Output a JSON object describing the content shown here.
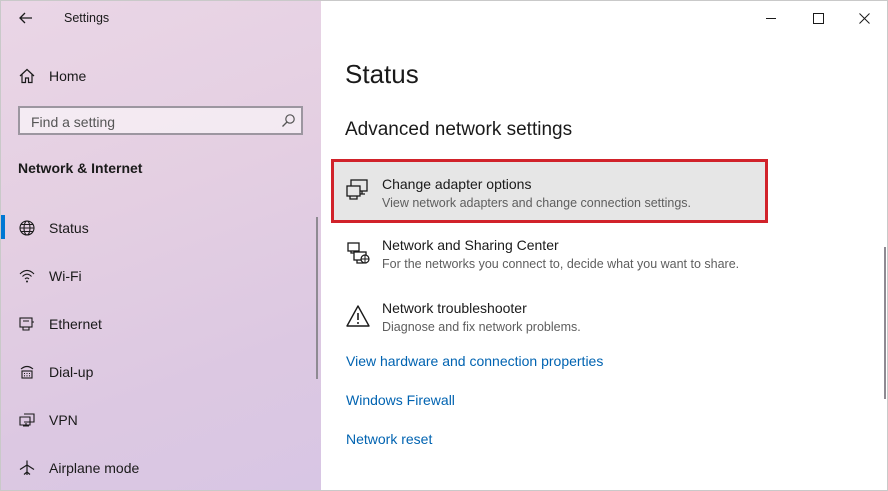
{
  "window": {
    "app_title": "Settings",
    "back_icon": "arrow-left-icon",
    "controls": {
      "minimize_icon": "minimize-icon",
      "maximize_icon": "maximize-icon",
      "close_icon": "close-icon"
    }
  },
  "sidebar": {
    "home_label": "Home",
    "search_placeholder": "Find a setting",
    "section_title": "Network & Internet",
    "items": [
      {
        "label": "Status",
        "icon": "globe-icon",
        "selected": true
      },
      {
        "label": "Wi-Fi",
        "icon": "wifi-icon",
        "selected": false
      },
      {
        "label": "Ethernet",
        "icon": "ethernet-icon",
        "selected": false
      },
      {
        "label": "Dial-up",
        "icon": "dialup-icon",
        "selected": false
      },
      {
        "label": "VPN",
        "icon": "vpn-icon",
        "selected": false
      },
      {
        "label": "Airplane mode",
        "icon": "airplane-icon",
        "selected": false
      }
    ]
  },
  "main": {
    "title": "Status",
    "section_title": "Advanced network settings",
    "options": [
      {
        "title": "Change adapter options",
        "description": "View network adapters and change connection settings.",
        "icon": "network-adapter-icon",
        "highlighted": true
      },
      {
        "title": "Network and Sharing Center",
        "description": "For the networks you connect to, decide what you want to share.",
        "icon": "sharing-center-icon",
        "highlighted": false
      },
      {
        "title": "Network troubleshooter",
        "description": "Diagnose and fix network problems.",
        "icon": "warning-icon",
        "highlighted": false
      }
    ],
    "links": [
      "View hardware and connection properties",
      "Windows Firewall",
      "Network reset"
    ]
  },
  "colors": {
    "accent": "#0078d4",
    "link": "#0063b1",
    "highlight_border": "#d1222a"
  }
}
